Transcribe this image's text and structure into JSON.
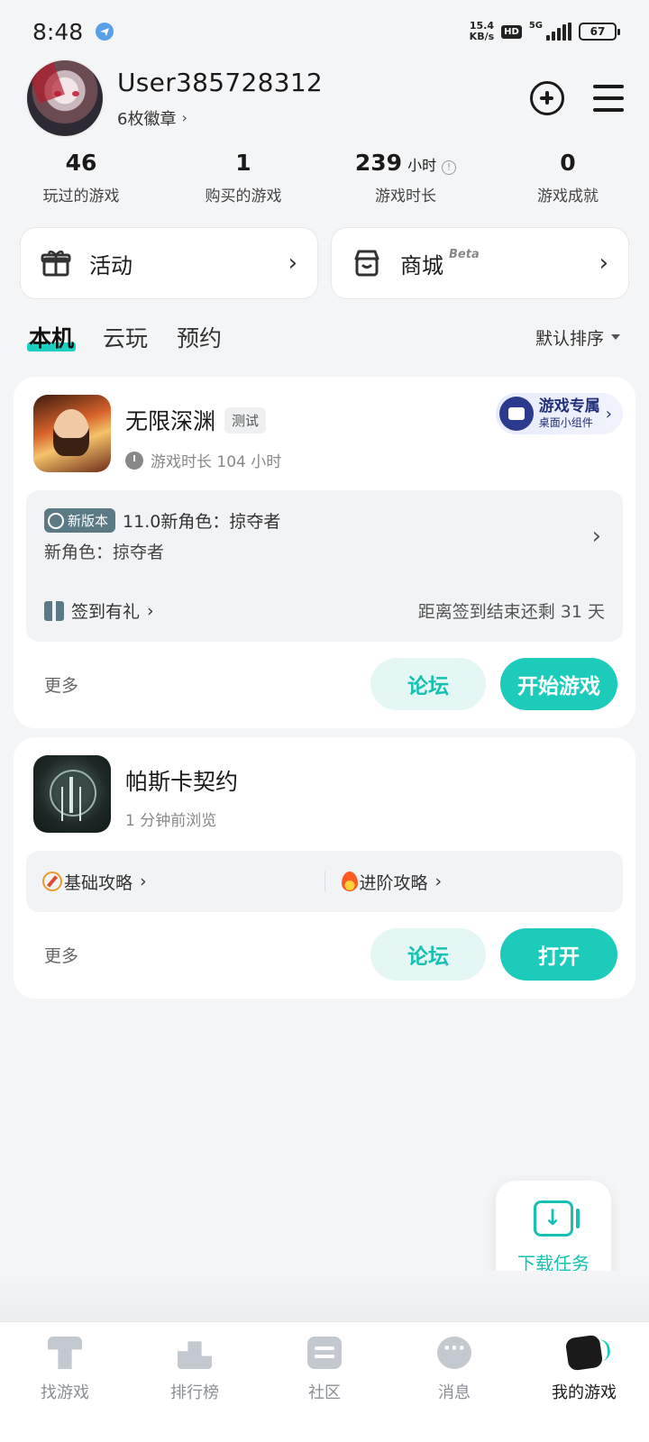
{
  "status_bar": {
    "time": "8:48",
    "net_speed_value": "15.4",
    "net_speed_unit": "KB/s",
    "hd": "HD",
    "network": "5G",
    "battery": "67"
  },
  "profile": {
    "username": "User385728312",
    "badges": "6枚徽章",
    "add_icon": "plus-circle-icon",
    "menu_icon": "hamburger-menu-icon"
  },
  "stats": [
    {
      "value": "46",
      "unit": "",
      "label": "玩过的游戏"
    },
    {
      "value": "1",
      "unit": "",
      "label": "购买的游戏"
    },
    {
      "value": "239",
      "unit": "小时",
      "label": "游戏时长"
    },
    {
      "value": "0",
      "unit": "",
      "label": "游戏成就"
    }
  ],
  "quick": {
    "activity": "活动",
    "store": "商城",
    "store_tag": "Beta"
  },
  "tabs": [
    "本机",
    "云玩",
    "预约"
  ],
  "sort_label": "默认排序",
  "games": [
    {
      "title": "无限深渊",
      "tag": "测试",
      "sub": "游戏时长 104 小时",
      "widget_title": "游戏专属",
      "widget_sub": "桌面小组件",
      "news_badge": "新版本",
      "news_title": "11.0新角色：掠夺者",
      "news_desc": "新角色：掠夺者",
      "checkin": "签到有礼",
      "checkin_remaining": "距离签到结束还剩 31 天",
      "more": "更多",
      "forum": "论坛",
      "primary": "开始游戏"
    },
    {
      "title": "帕斯卡契约",
      "sub": "1 分钟前浏览",
      "guide_basic": "基础攻略",
      "guide_advanced": "进阶攻略",
      "more": "更多",
      "forum": "论坛",
      "primary": "打开"
    }
  ],
  "download_task": "下载任务",
  "bottom_nav": [
    {
      "label": "找游戏",
      "icon": "find-game-icon"
    },
    {
      "label": "排行榜",
      "icon": "ranking-icon"
    },
    {
      "label": "社区",
      "icon": "community-icon"
    },
    {
      "label": "消息",
      "icon": "message-icon"
    },
    {
      "label": "我的游戏",
      "icon": "my-games-icon"
    }
  ],
  "colors": {
    "accent": "#1dcbbb",
    "background": "#f4f5f7",
    "widget_text": "#22307a"
  }
}
